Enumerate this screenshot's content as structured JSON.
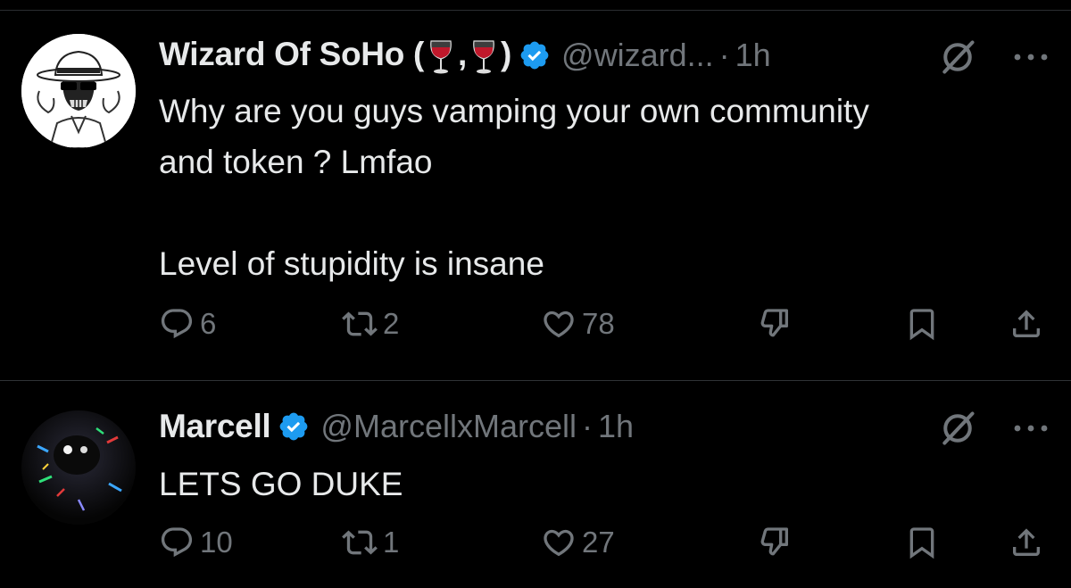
{
  "tweets": [
    {
      "display_name_prefix": "Wizard Of SoHo (",
      "display_name_sep": ",",
      "display_name_suffix": ")",
      "handle": "@wizard...",
      "separator": "·",
      "time": "1h",
      "body_lines": [
        "Why are you guys vamping your own community",
        "and token ? Lmfao",
        "",
        "Level of stupidity is insane"
      ],
      "replies": "6",
      "reposts": "2",
      "likes": "78"
    },
    {
      "display_name": "Marcell",
      "handle": "@MarcellxMarcell",
      "separator": "·",
      "time": "1h",
      "body_lines": [
        "LETS GO DUKE"
      ],
      "replies": "10",
      "reposts": "1",
      "likes": "27"
    }
  ],
  "icons": [
    "verified-badge-icon",
    "wine-glass-icon",
    "grok-icon",
    "more-icon",
    "reply-icon",
    "repost-icon",
    "like-icon",
    "dislike-icon",
    "bookmark-icon",
    "share-icon"
  ],
  "colors": {
    "background": "#000000",
    "text": "#e7e9ea",
    "secondary": "#71767b",
    "verified": "#1d9bf0",
    "divider": "#2f3336"
  }
}
